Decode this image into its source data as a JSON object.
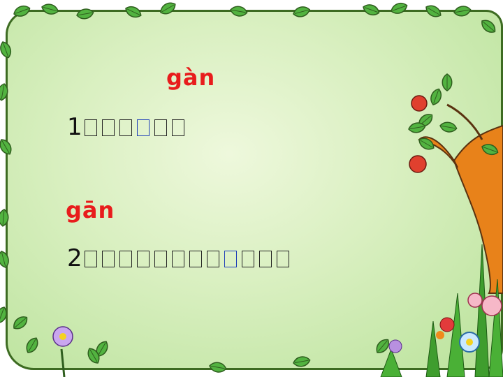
{
  "slide": {
    "lines": [
      {
        "pinyin": "gàn",
        "number": "1",
        "glyph_count": 6,
        "highlight_index": 3
      },
      {
        "pinyin": "gān",
        "number": "2",
        "glyph_count": 12,
        "highlight_index": 8
      }
    ],
    "colors": {
      "pinyin": "#e81c1c",
      "text": "#111111",
      "highlight": "#1f3fb8",
      "background": "#d8efbf",
      "leaf": "#4aa83a",
      "leaf_border": "#2f5e1e",
      "apple": "#e0402e",
      "trunk": "#e07a14"
    },
    "icons": [
      "leaf-border",
      "apple-tree-icon",
      "flower-icon"
    ]
  }
}
